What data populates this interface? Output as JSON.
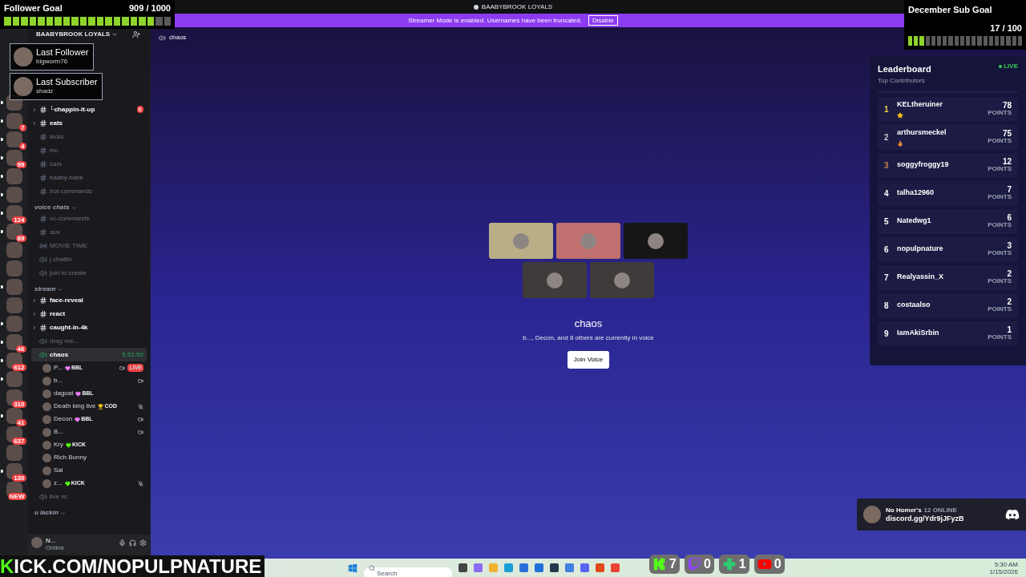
{
  "window": {
    "title": "BAABYBROOK LOYALS"
  },
  "banner": {
    "text": "Streamer Mode is enabled. Usernames have been truncated.",
    "button": "Disable"
  },
  "servers": [
    {
      "unread": true
    },
    {
      "unread": true,
      "badge": "7"
    },
    {
      "unread": true,
      "badge": "4"
    },
    {
      "unread": true,
      "badge": "99"
    },
    {
      "unread": true
    },
    {
      "unread": true
    },
    {
      "unread": true,
      "badge": "124"
    },
    {
      "unread": true,
      "badge": "89"
    },
    {
      "unread": false
    },
    {
      "unread": false
    },
    {
      "unread": true
    },
    {
      "unread": false
    },
    {
      "unread": true
    },
    {
      "unread": true,
      "badge": "46"
    },
    {
      "unread": true,
      "badge": "612"
    },
    {
      "unread": true
    },
    {
      "unread": false,
      "badge": "310"
    },
    {
      "unread": true,
      "badge": "41"
    },
    {
      "unread": false,
      "badge": "637"
    },
    {
      "unread": false
    },
    {
      "unread": true,
      "badge": "130"
    },
    {
      "unread": false,
      "badge": "NEW"
    }
  ],
  "server_name": "BAABYBROOK LOYALS",
  "channels": [
    {
      "kind": "text",
      "name": "└chappin-it-up",
      "unread": true,
      "arrow": true,
      "badge": "6",
      "selected": false
    },
    {
      "kind": "text",
      "name": "eats",
      "unread": true,
      "arrow": true,
      "selected": false
    },
    {
      "kind": "text",
      "name": "kicks",
      "unread": false,
      "arrow": false,
      "selected": false
    },
    {
      "kind": "text",
      "name": "mc",
      "unread": false,
      "arrow": false,
      "selected": false
    },
    {
      "kind": "text",
      "name": "cars",
      "unread": false,
      "arrow": false,
      "selected": false
    },
    {
      "kind": "text",
      "name": "baaby-bank",
      "unread": false,
      "arrow": false,
      "selected": false
    },
    {
      "kind": "text",
      "name": "bot-commands",
      "unread": false,
      "arrow": false,
      "selected": false
    },
    {
      "kind": "category",
      "name": "voice chats"
    },
    {
      "kind": "text",
      "name": "vc-commands",
      "unread": false,
      "arrow": false,
      "selected": false
    },
    {
      "kind": "text",
      "name": "aux",
      "unread": false,
      "arrow": false,
      "selected": false
    },
    {
      "kind": "stage",
      "name": "MOVIE TIME",
      "unread": false,
      "arrow": false,
      "selected": false
    },
    {
      "kind": "voice",
      "name": "j chattin",
      "unread": false,
      "arrow": false,
      "selected": false
    },
    {
      "kind": "voice",
      "name": "join to create",
      "unread": false,
      "arrow": false,
      "selected": false
    },
    {
      "kind": "category",
      "name": "stream"
    },
    {
      "kind": "text",
      "name": "face-reveal",
      "unread": true,
      "arrow": true,
      "selected": false
    },
    {
      "kind": "text",
      "name": "react",
      "unread": true,
      "arrow": true,
      "selected": false
    },
    {
      "kind": "text",
      "name": "caught-in-4k",
      "unread": true,
      "arrow": true,
      "selected": false
    },
    {
      "kind": "voice",
      "name": "drag me...",
      "unread": false,
      "arrow": false,
      "selected": false
    },
    {
      "kind": "voice",
      "name": "chaos",
      "unread": true,
      "arrow": false,
      "selected": true,
      "timer": "5:51:50",
      "members": [
        {
          "name": "P...",
          "tag": {
            "kind": "heart",
            "color": "#f47fff",
            "text": "BBL"
          },
          "camera": true,
          "muted": false,
          "live": "LIVE"
        },
        {
          "name": "b...",
          "camera": true,
          "muted": false
        },
        {
          "name": "dagoat",
          "tag": {
            "kind": "heart",
            "color": "#f47fff",
            "text": "BBL"
          },
          "camera": false,
          "muted": false
        },
        {
          "name": "Death king live",
          "tag": {
            "kind": "trophy",
            "color": "#f0c419",
            "text": "COD"
          },
          "camera": false,
          "muted": true
        },
        {
          "name": "Decon",
          "tag": {
            "kind": "heart",
            "color": "#f47fff",
            "text": "BBL"
          },
          "camera": true,
          "muted": false
        },
        {
          "name": "B...",
          "camera": true,
          "muted": false
        },
        {
          "name": "Kry",
          "tag": {
            "kind": "heart",
            "color": "#53fc18",
            "text": "KICK"
          },
          "camera": false,
          "muted": false
        },
        {
          "name": "Rich Bunny",
          "camera": false,
          "muted": false
        },
        {
          "name": "Sal",
          "camera": false,
          "muted": false
        },
        {
          "name": "z...",
          "tag": {
            "kind": "heart",
            "color": "#53fc18",
            "text": "KICK"
          },
          "camera": false,
          "muted": true
        }
      ]
    },
    {
      "kind": "voice",
      "name": "live vc",
      "unread": false,
      "arrow": false,
      "selected": false
    },
    {
      "kind": "category",
      "name": "u lackin"
    }
  ],
  "user_panel": {
    "name": "N...",
    "status": "Online"
  },
  "main": {
    "channel": "chaos",
    "tiles": [
      {
        "color": "#b9ae86"
      },
      {
        "color": "#c0706e"
      },
      {
        "color": "#161616"
      },
      {
        "color": "#3f3b3a"
      },
      {
        "color": "#3f3b3a"
      }
    ],
    "title": "chaos",
    "subtitle": "b..., Decon, and 8 others are currently in voice",
    "button": "Join Voice"
  },
  "follower_goal": {
    "title": "Follower Goal",
    "count": "909 / 1000",
    "level": 0.9
  },
  "last_follower": {
    "title": "Last Follower",
    "name": "bigworm76"
  },
  "last_subscriber": {
    "title": "Last Subscriber",
    "name": "shadz"
  },
  "sub_goal": {
    "title": "December Sub Goal",
    "count": "17 / 100",
    "level": 0.17
  },
  "leaderboard": {
    "title": "Leaderboard",
    "subtitle": "Top Contributors",
    "live": "LIVE",
    "rows": [
      {
        "rank": "1",
        "name": "KELtheruiner",
        "kind": "star",
        "points": "78",
        "unit": "POINTS",
        "color": "#f5d142"
      },
      {
        "rank": "2",
        "name": "arthursmeckel",
        "kind": "flame",
        "points": "75",
        "unit": "POINTS",
        "color": "#c7c7d1"
      },
      {
        "rank": "3",
        "kind": "plain",
        "name": "soggyfroggy19",
        "points": "12",
        "unit": "POINTS",
        "color": "#c9834f"
      },
      {
        "rank": "4",
        "kind": "plain",
        "name": "talha12960",
        "points": "7",
        "unit": "POINTS",
        "color": "#ffffff"
      },
      {
        "rank": "5",
        "kind": "plain",
        "name": "Natedwg1",
        "points": "6",
        "unit": "POINTS",
        "color": "#ffffff"
      },
      {
        "rank": "6",
        "kind": "plain",
        "name": "nopulpnature",
        "points": "3",
        "unit": "POINTS",
        "color": "#ffffff"
      },
      {
        "rank": "7",
        "kind": "plain",
        "name": "Realyassin_X",
        "points": "2",
        "unit": "POINTS",
        "color": "#ffffff"
      },
      {
        "rank": "8",
        "kind": "plain",
        "name": "costaalso",
        "points": "2",
        "unit": "POINTS",
        "color": "#ffffff"
      },
      {
        "rank": "9",
        "kind": "plain",
        "name": "IamAkiSrbin",
        "points": "1",
        "unit": "POINTS",
        "color": "#ffffff"
      }
    ]
  },
  "discord_widget": {
    "name": "No Homer's",
    "online": "12 ONLINE",
    "link": "discord.gg/Ydr9jJFyzB"
  },
  "kick_banner": "KICK.COM/NOPULPNATURE",
  "taskbar": {
    "search_placeholder": "Search",
    "time": "5:30 AM",
    "date": "1/15/2026"
  },
  "socials": [
    {
      "kind": "kick",
      "count": "7"
    },
    {
      "kind": "twitch",
      "count": "0"
    },
    {
      "kind": "plus",
      "count": "1"
    },
    {
      "kind": "youtube",
      "count": "0"
    }
  ]
}
